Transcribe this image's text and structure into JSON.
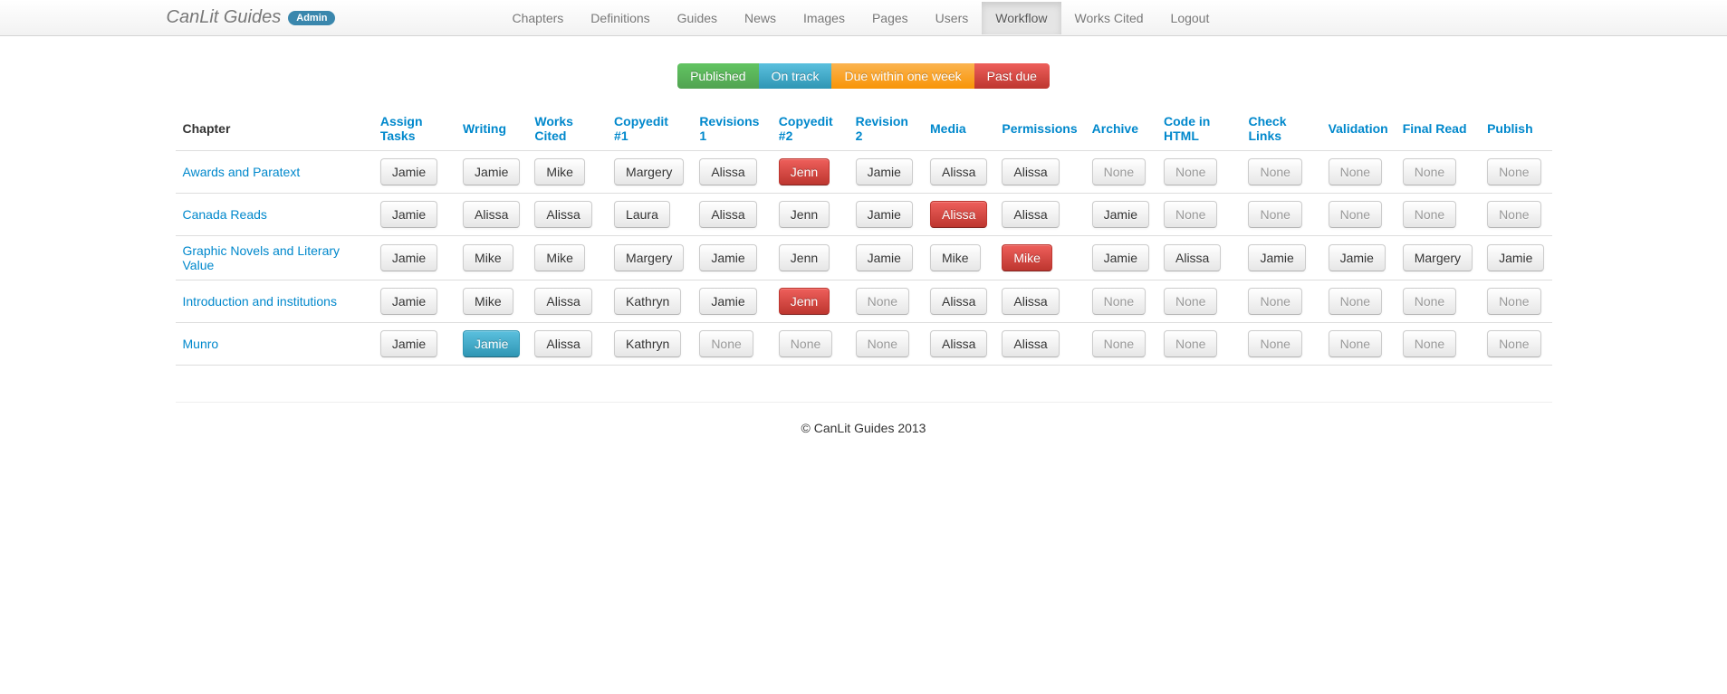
{
  "brand": {
    "title": "CanLit Guides",
    "badge": "Admin"
  },
  "nav": {
    "items": [
      {
        "label": "Chapters"
      },
      {
        "label": "Definitions"
      },
      {
        "label": "Guides"
      },
      {
        "label": "News"
      },
      {
        "label": "Images"
      },
      {
        "label": "Pages"
      },
      {
        "label": "Users"
      },
      {
        "label": "Workflow",
        "active": true
      },
      {
        "label": "Works Cited"
      },
      {
        "label": "Logout"
      }
    ]
  },
  "legend": {
    "published": "Published",
    "ontrack": "On track",
    "dueweek": "Due within one week",
    "pastdue": "Past due"
  },
  "columns": [
    "Chapter",
    "Assign Tasks",
    "Writing",
    "Works Cited",
    "Copyedit #1",
    "Revisions 1",
    "Copyedit #2",
    "Revision 2",
    "Media",
    "Permissions",
    "Archive",
    "Code in HTML",
    "Check Links",
    "Validation",
    "Final Read",
    "Publish"
  ],
  "rows": [
    {
      "chapter": "Awards and Paratext",
      "cells": [
        {
          "label": "Jamie",
          "status": "default"
        },
        {
          "label": "Jamie",
          "status": "default"
        },
        {
          "label": "Mike",
          "status": "default"
        },
        {
          "label": "Margery",
          "status": "default"
        },
        {
          "label": "Alissa",
          "status": "default"
        },
        {
          "label": "Jenn",
          "status": "danger"
        },
        {
          "label": "Jamie",
          "status": "default"
        },
        {
          "label": "Alissa",
          "status": "default"
        },
        {
          "label": "Alissa",
          "status": "default"
        },
        {
          "label": "None",
          "status": "none"
        },
        {
          "label": "None",
          "status": "none"
        },
        {
          "label": "None",
          "status": "none"
        },
        {
          "label": "None",
          "status": "none"
        },
        {
          "label": "None",
          "status": "none"
        },
        {
          "label": "None",
          "status": "none"
        }
      ]
    },
    {
      "chapter": "Canada Reads",
      "cells": [
        {
          "label": "Jamie",
          "status": "default"
        },
        {
          "label": "Alissa",
          "status": "default"
        },
        {
          "label": "Alissa",
          "status": "default"
        },
        {
          "label": "Laura",
          "status": "default"
        },
        {
          "label": "Alissa",
          "status": "default"
        },
        {
          "label": "Jenn",
          "status": "default"
        },
        {
          "label": "Jamie",
          "status": "default"
        },
        {
          "label": "Alissa",
          "status": "danger"
        },
        {
          "label": "Alissa",
          "status": "default"
        },
        {
          "label": "Jamie",
          "status": "default"
        },
        {
          "label": "None",
          "status": "none"
        },
        {
          "label": "None",
          "status": "none"
        },
        {
          "label": "None",
          "status": "none"
        },
        {
          "label": "None",
          "status": "none"
        },
        {
          "label": "None",
          "status": "none"
        }
      ]
    },
    {
      "chapter": "Graphic Novels and Literary Value",
      "cells": [
        {
          "label": "Jamie",
          "status": "default"
        },
        {
          "label": "Mike",
          "status": "default"
        },
        {
          "label": "Mike",
          "status": "default"
        },
        {
          "label": "Margery",
          "status": "default"
        },
        {
          "label": "Jamie",
          "status": "default"
        },
        {
          "label": "Jenn",
          "status": "default"
        },
        {
          "label": "Jamie",
          "status": "default"
        },
        {
          "label": "Mike",
          "status": "default"
        },
        {
          "label": "Mike",
          "status": "danger"
        },
        {
          "label": "Jamie",
          "status": "default"
        },
        {
          "label": "Alissa",
          "status": "default"
        },
        {
          "label": "Jamie",
          "status": "default"
        },
        {
          "label": "Jamie",
          "status": "default"
        },
        {
          "label": "Margery",
          "status": "default"
        },
        {
          "label": "Jamie",
          "status": "default"
        }
      ]
    },
    {
      "chapter": "Introduction and institutions",
      "cells": [
        {
          "label": "Jamie",
          "status": "default"
        },
        {
          "label": "Mike",
          "status": "default"
        },
        {
          "label": "Alissa",
          "status": "default"
        },
        {
          "label": "Kathryn",
          "status": "default"
        },
        {
          "label": "Jamie",
          "status": "default"
        },
        {
          "label": "Jenn",
          "status": "danger"
        },
        {
          "label": "None",
          "status": "none"
        },
        {
          "label": "Alissa",
          "status": "default"
        },
        {
          "label": "Alissa",
          "status": "default"
        },
        {
          "label": "None",
          "status": "none"
        },
        {
          "label": "None",
          "status": "none"
        },
        {
          "label": "None",
          "status": "none"
        },
        {
          "label": "None",
          "status": "none"
        },
        {
          "label": "None",
          "status": "none"
        },
        {
          "label": "None",
          "status": "none"
        }
      ]
    },
    {
      "chapter": "Munro",
      "cells": [
        {
          "label": "Jamie",
          "status": "default"
        },
        {
          "label": "Jamie",
          "status": "info"
        },
        {
          "label": "Alissa",
          "status": "default"
        },
        {
          "label": "Kathryn",
          "status": "default"
        },
        {
          "label": "None",
          "status": "none"
        },
        {
          "label": "None",
          "status": "none"
        },
        {
          "label": "None",
          "status": "none"
        },
        {
          "label": "Alissa",
          "status": "default"
        },
        {
          "label": "Alissa",
          "status": "default"
        },
        {
          "label": "None",
          "status": "none"
        },
        {
          "label": "None",
          "status": "none"
        },
        {
          "label": "None",
          "status": "none"
        },
        {
          "label": "None",
          "status": "none"
        },
        {
          "label": "None",
          "status": "none"
        },
        {
          "label": "None",
          "status": "none"
        }
      ]
    }
  ],
  "footer": "© CanLit Guides 2013"
}
